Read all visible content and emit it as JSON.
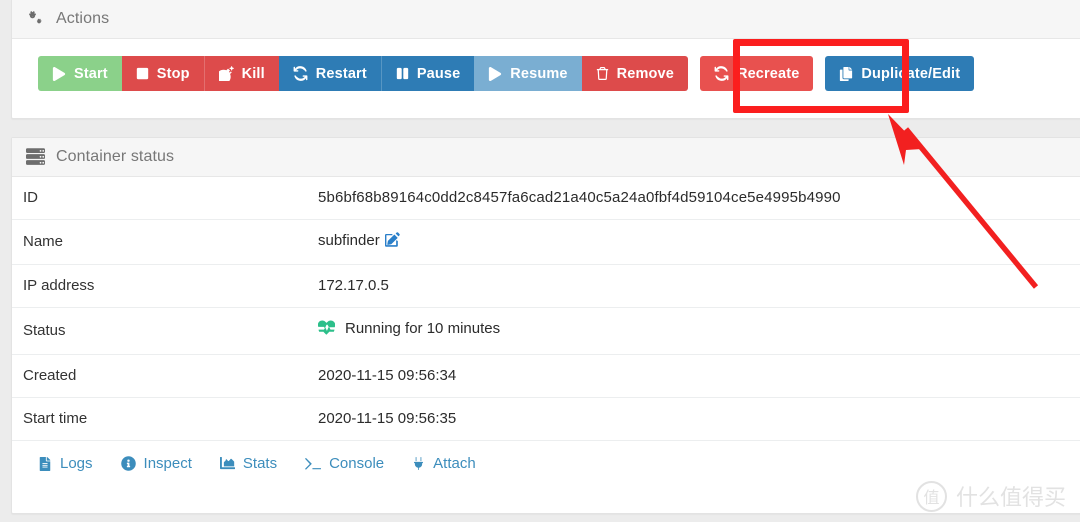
{
  "theme": {
    "page_bg": "#ececec",
    "card_bg": "#ffffff",
    "header_bg": "#f6f6f6",
    "link_blue": "#3c8dbc",
    "annotation_red": "#fb1e1e"
  },
  "actions_card": {
    "title": "Actions",
    "icon": "cogs-icon",
    "button_groups": [
      {
        "buttons": [
          {
            "label": "Start",
            "icon": "play-icon",
            "color": "#8bd18a"
          },
          {
            "label": "Stop",
            "icon": "stop-icon",
            "color": "#dd4b4b"
          },
          {
            "label": "Kill",
            "icon": "bomb-icon",
            "color": "#dd4b4b"
          },
          {
            "label": "Restart",
            "icon": "sync-icon",
            "color": "#2e7cb5"
          },
          {
            "label": "Pause",
            "icon": "pause-icon",
            "color": "#2e7cb5"
          },
          {
            "label": "Resume",
            "icon": "play-icon",
            "color": "#7aaed2"
          },
          {
            "label": "Remove",
            "icon": "trash-icon",
            "color": "#dd4b4b"
          }
        ]
      },
      {
        "buttons": [
          {
            "label": "Recreate",
            "icon": "sync-icon",
            "color": "#e8514f"
          },
          {
            "label": "Duplicate/Edit",
            "icon": "copy-icon",
            "color": "#2e7cb5"
          }
        ]
      }
    ]
  },
  "status_card": {
    "title": "Container status",
    "icon": "server-icon",
    "rows": [
      {
        "key": "ID",
        "value": "5b6bf68b89164c0dd2c8457fa6cad21a40c5a24a0fbf4d59104ce5e4995b4990",
        "type": "text"
      },
      {
        "key": "Name",
        "value": "subfinder",
        "type": "editable",
        "edit_icon": "edit-square-icon"
      },
      {
        "key": "IP address",
        "value": "172.17.0.5",
        "type": "text"
      },
      {
        "key": "Status",
        "value": "Running for 10 minutes",
        "type": "status",
        "status_icon": "heartbeat-icon",
        "status_color": "#2cbf8a"
      },
      {
        "key": "Created",
        "value": "2020-11-15 09:56:34",
        "type": "text"
      },
      {
        "key": "Start time",
        "value": "2020-11-15 09:56:35",
        "type": "text"
      }
    ],
    "footer_links": [
      {
        "label": "Logs",
        "icon": "file-lines-icon"
      },
      {
        "label": "Inspect",
        "icon": "info-circle-icon"
      },
      {
        "label": "Stats",
        "icon": "chart-area-icon"
      },
      {
        "label": "Console",
        "icon": "terminal-icon"
      },
      {
        "label": "Attach",
        "icon": "plug-icon"
      }
    ]
  },
  "annotations": {
    "highlight_target": "Duplicate/Edit",
    "box_color": "#fb1e1e",
    "arrow_color": "#f22020"
  },
  "watermark": {
    "badge": "值",
    "text": "什么值得买"
  }
}
